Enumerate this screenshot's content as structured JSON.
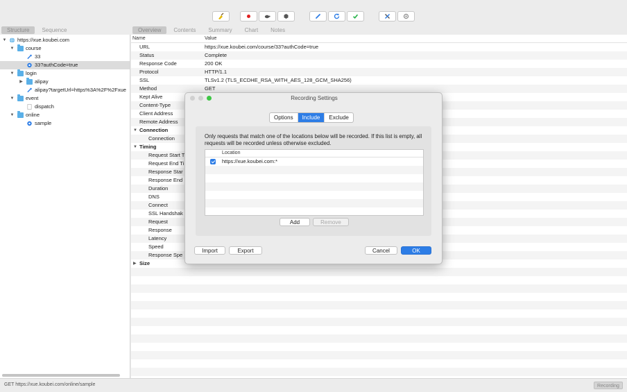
{
  "toolbar": {
    "buttons": [
      {
        "icon": "broom-icon"
      },
      {
        "icon": "record-icon"
      },
      {
        "icon": "turtle-icon"
      },
      {
        "icon": "breakpoint-icon"
      },
      {
        "icon": "pen-icon"
      },
      {
        "icon": "refresh-icon"
      },
      {
        "icon": "checkmark-icon"
      },
      {
        "icon": "tools-icon"
      },
      {
        "icon": "settings-icon"
      }
    ]
  },
  "left_tabs": [
    {
      "label": "Structure"
    },
    {
      "label": "Sequence"
    }
  ],
  "right_tabs": [
    {
      "label": "Overview"
    },
    {
      "label": "Contents"
    },
    {
      "label": "Summary"
    },
    {
      "label": "Chart"
    },
    {
      "label": "Notes"
    }
  ],
  "tree": [
    {
      "label": "https://xue.koubei.com"
    },
    {
      "label": "course"
    },
    {
      "label": "33"
    },
    {
      "label": "33?authCode=true"
    },
    {
      "label": "login"
    },
    {
      "label": "alipay"
    },
    {
      "label": "alipay?targetUrl=https%3A%2F%2Fxue"
    },
    {
      "label": "event"
    },
    {
      "label": "dispatch"
    },
    {
      "label": "online"
    },
    {
      "label": "sample"
    }
  ],
  "overview": {
    "col_name": "Name",
    "col_value": "Value",
    "rows": [
      {
        "name": "URL",
        "value": "https://xue.koubei.com/course/33?authCode=true"
      },
      {
        "name": "Status",
        "value": "Complete"
      },
      {
        "name": "Response Code",
        "value": "200 OK"
      },
      {
        "name": "Protocol",
        "value": "HTTP/1.1"
      },
      {
        "name": "SSL",
        "value": "TLSv1.2 (TLS_ECDHE_RSA_WITH_AES_128_GCM_SHA256)"
      },
      {
        "name": "Method",
        "value": "GET"
      },
      {
        "name": "Kept Alive",
        "value": ""
      },
      {
        "name": "Content-Type",
        "value": ""
      },
      {
        "name": "Client Address",
        "value": ""
      },
      {
        "name": "Remote Address",
        "value": ""
      },
      {
        "name": "Connection",
        "value": ""
      },
      {
        "name": "Connection",
        "value": ""
      },
      {
        "name": "Timing",
        "value": ""
      },
      {
        "name": "Request Start T",
        "value": ""
      },
      {
        "name": "Request End Ti",
        "value": ""
      },
      {
        "name": "Response Star",
        "value": ""
      },
      {
        "name": "Response End",
        "value": ""
      },
      {
        "name": "Duration",
        "value": ""
      },
      {
        "name": "DNS",
        "value": ""
      },
      {
        "name": "Connect",
        "value": ""
      },
      {
        "name": "SSL Handshak",
        "value": ""
      },
      {
        "name": "Request",
        "value": ""
      },
      {
        "name": "Response",
        "value": ""
      },
      {
        "name": "Latency",
        "value": ""
      },
      {
        "name": "Speed",
        "value": ""
      },
      {
        "name": "Response Spe",
        "value": ""
      },
      {
        "name": "Size",
        "value": ""
      }
    ]
  },
  "status_bar": {
    "text": "GET https://xue.koubei.com/online/sample",
    "badge": "Recording"
  },
  "dialog": {
    "title": "Recording Settings",
    "tabs": [
      {
        "label": "Options"
      },
      {
        "label": "Include"
      },
      {
        "label": "Exclude"
      }
    ],
    "description": "Only requests that match one of the locations below will be recorded. If this list is empty, all requests will be recorded unless otherwise excluded.",
    "list_header": "Location",
    "locations": [
      {
        "value": "https://xue.koubei.com:*",
        "checked": true
      }
    ],
    "add_label": "Add",
    "remove_label": "Remove",
    "import_label": "Import",
    "export_label": "Export",
    "cancel_label": "Cancel",
    "ok_label": "OK"
  },
  "colors": {
    "accent": "#2d7de6",
    "folder": "#5ab0e8",
    "record": "#e02020",
    "check": "#27b34a",
    "refresh": "#2d7de6"
  }
}
